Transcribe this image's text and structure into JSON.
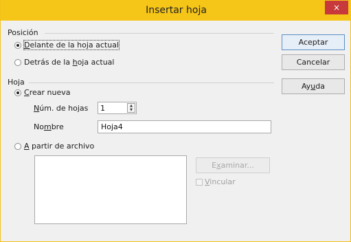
{
  "window": {
    "title": "Insertar hoja",
    "close_glyph": "×"
  },
  "position": {
    "label": "Posición",
    "options": [
      {
        "label_pre": "",
        "label_key": "D",
        "label_post": "elante de la hoja actual",
        "checked": true
      },
      {
        "label_pre": "Detrás de la ",
        "label_key": "h",
        "label_post": "oja actual",
        "checked": false
      }
    ]
  },
  "sheet": {
    "label": "Hoja",
    "new": {
      "label_pre": "",
      "label_key": "C",
      "label_post": "rear nueva",
      "checked": true
    },
    "count": {
      "label_pre": "",
      "label_key": "N",
      "label_post": "úm. de hojas",
      "value": "1"
    },
    "name": {
      "label_pre": "No",
      "label_key": "m",
      "label_post": "bre",
      "value": "Hoja4"
    },
    "from_file": {
      "label_pre": "",
      "label_key": "A",
      "label_post": " partir de archivo",
      "checked": false
    },
    "browse": {
      "label_pre": "E",
      "label_key": "x",
      "label_post": "aminar..."
    },
    "link": {
      "label_pre": "",
      "label_key": "V",
      "label_post": "incular",
      "checked": false
    }
  },
  "buttons": {
    "ok": "Aceptar",
    "cancel": "Cancelar",
    "help_pre": "Ay",
    "help_key": "u",
    "help_post": "da"
  },
  "icons": {
    "spin_up": "▲",
    "spin_down": "▼"
  },
  "colors": {
    "titlebar": "#f5c518",
    "close": "#c7393a"
  }
}
